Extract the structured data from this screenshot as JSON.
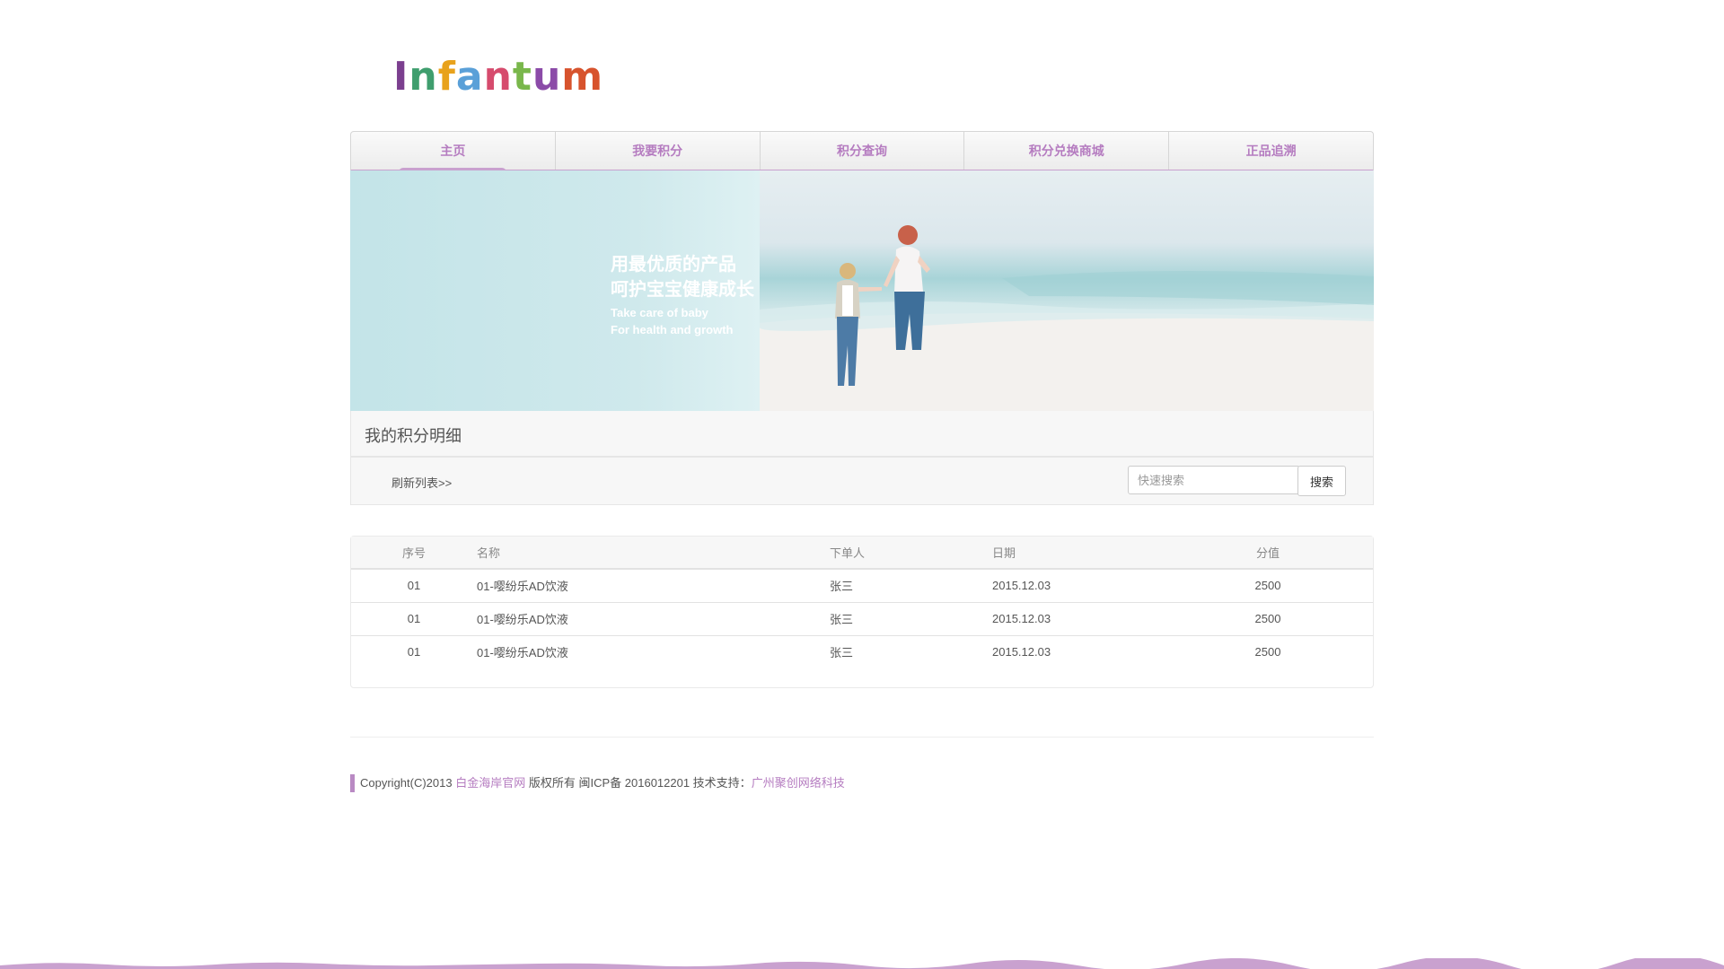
{
  "logo": {
    "letters": [
      "I",
      "n",
      "f",
      "a",
      "n",
      "t",
      "u",
      "m"
    ],
    "colors": [
      "#7b3f8f",
      "#3f9e6e",
      "#e8a21c",
      "#5aa0d8",
      "#d64b6d",
      "#79b74b",
      "#8b4ba8",
      "#d7532d"
    ]
  },
  "nav": {
    "items": [
      {
        "label": "主页"
      },
      {
        "label": "我要积分"
      },
      {
        "label": "积分查询"
      },
      {
        "label": "积分兑换商城"
      },
      {
        "label": "正品追溯"
      }
    ],
    "active_index": 0
  },
  "banner": {
    "cn_line1": "用最优质的产品",
    "cn_line2": "呵护宝宝健康成长",
    "en_line1": "Take care of baby",
    "en_line2": "For health and growth"
  },
  "section": {
    "title": "我的积分明细"
  },
  "toolbar": {
    "refresh_label": "刷新列表>>",
    "search_placeholder": "快速搜索",
    "search_button": "搜索"
  },
  "table": {
    "headers": [
      "序号",
      "名称",
      "下单人",
      "日期",
      "分值"
    ],
    "rows": [
      [
        "01",
        "01-嘤纷乐AD饮液",
        "张三",
        "2015.12.03",
        "2500"
      ],
      [
        "01",
        "01-嘤纷乐AD饮液",
        "张三",
        "2015.12.03",
        "2500"
      ],
      [
        "01",
        "01-嘤纷乐AD饮液",
        "张三",
        "2015.12.03",
        "2500"
      ]
    ]
  },
  "footer": {
    "copyright": "Copyright(C)2013",
    "site_link": "白金海岸官网",
    "rights": "版权所有 闽ICP备 2016012201 技术支持：",
    "support_link": "广州聚创网络科技"
  },
  "colors": {
    "accent": "#b57cc0",
    "accent_dark": "#b98ac3"
  }
}
